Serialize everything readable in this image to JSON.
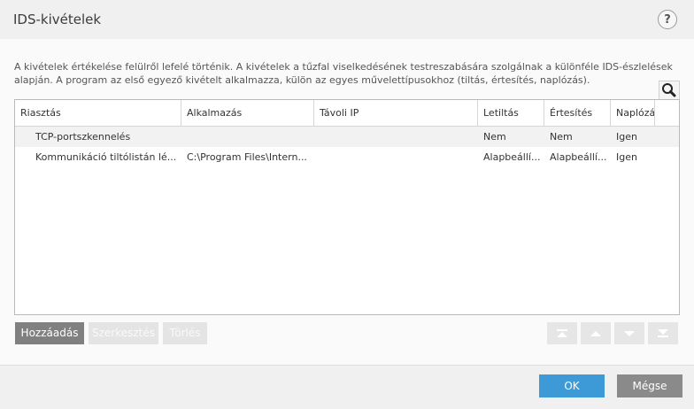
{
  "dialog": {
    "title": "IDS-kivételek",
    "help_glyph": "?"
  },
  "description": "A kivételek értékelése felülről lefelé történik. A kivételek a tűzfal viselkedésének testreszabására szolgálnak a különféle IDS-észlelések alapján. A program az első egyező kivételt alkalmazza, külön az egyes művelettípusokhoz (tiltás, értesítés, naplózás).",
  "table": {
    "columns": [
      "Riasztás",
      "Alkalmazás",
      "Távoli IP",
      "Letiltás",
      "Értesítés",
      "Naplózás"
    ],
    "rows": [
      {
        "alert": "TCP-portszkennelés",
        "app": "",
        "remote_ip": "",
        "block": "Nem",
        "notify": "Nem",
        "log": "Igen"
      },
      {
        "alert": "Kommunikáció tiltólistán lé...",
        "app": "C:\\Program Files\\Intern...",
        "remote_ip": "",
        "block": "Alapbeállí...",
        "notify": "Alapbeállí...",
        "log": "Igen"
      }
    ]
  },
  "buttons": {
    "add": "Hozzáadás",
    "edit": "Szerkesztés",
    "delete": "Törlés",
    "ok": "OK",
    "cancel": "Mégse"
  },
  "icons": {
    "search": "search-icon",
    "move_top": "move-top-icon",
    "move_up": "move-up-icon",
    "move_down": "move-down-icon",
    "move_bottom": "move-bottom-icon"
  },
  "colors": {
    "primary": "#3d9ad6",
    "secondary": "#8a8a8a",
    "add_button": "#808080"
  }
}
